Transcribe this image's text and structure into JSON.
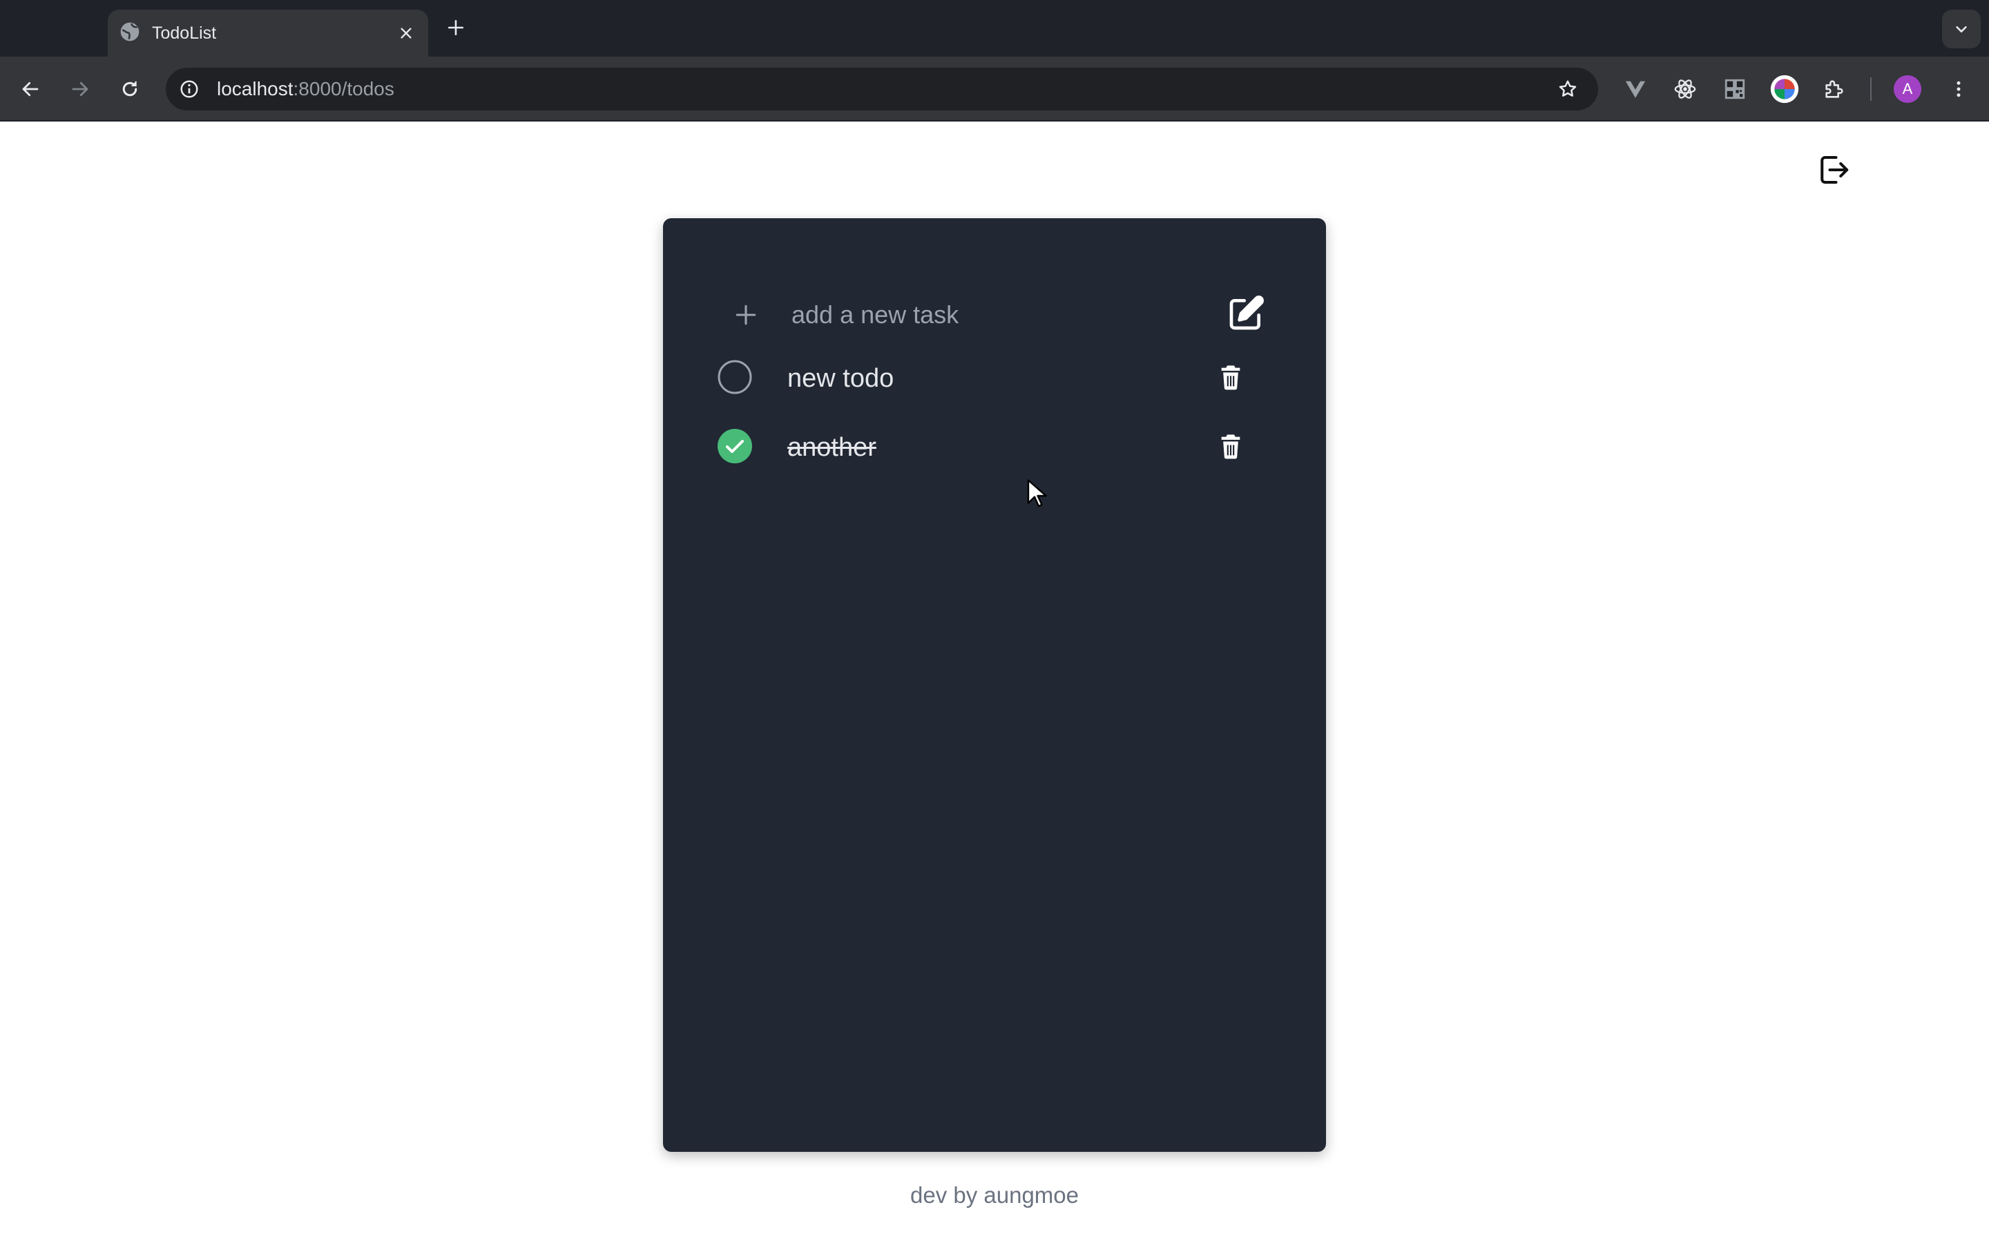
{
  "browser": {
    "tab_title": "TodoList",
    "url_host": "localhost",
    "url_path": ":8000/todos",
    "avatar_letter": "A",
    "icons": {
      "favicon": "globe-icon",
      "close": "close-icon",
      "new_tab": "plus-icon",
      "tab_menu": "chevron-down-icon",
      "back": "arrow-left-icon",
      "forward": "arrow-right-icon",
      "reload": "reload-icon",
      "site_info": "info-icon",
      "bookmark": "star-icon",
      "extensions": [
        "vue-devtools-icon",
        "react-devtools-icon",
        "qr-code-icon",
        "color-picker-icon",
        "puzzle-icon"
      ],
      "menu": "kebab-menu-icon"
    }
  },
  "page": {
    "logout_icon": "logout-icon",
    "add_placeholder": "add a new task",
    "todos": [
      {
        "text": "new todo",
        "done": false
      },
      {
        "text": "another",
        "done": true
      }
    ],
    "footer": "dev by aungmoe"
  },
  "colors": {
    "card": "#212733",
    "done_check": "#48bb78",
    "footer_text": "#6b7280"
  }
}
